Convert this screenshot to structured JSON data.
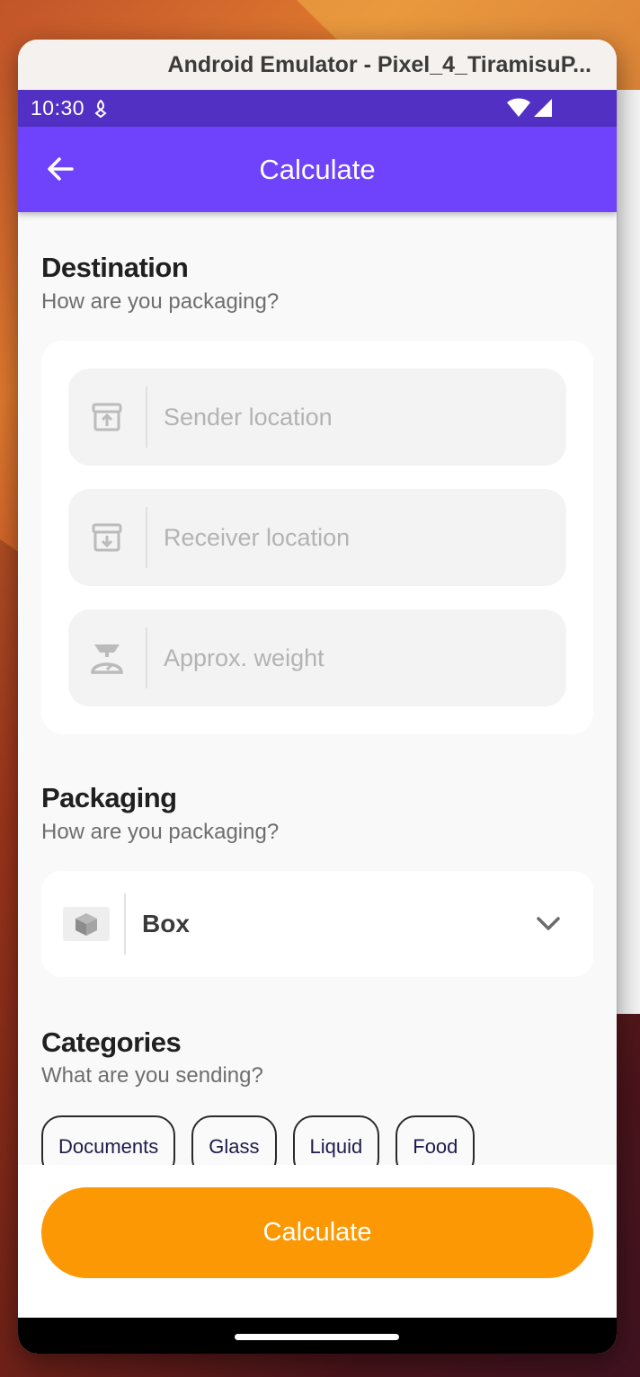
{
  "window": {
    "title": "Android Emulator - Pixel_4_TiramisuP..."
  },
  "status_bar": {
    "time": "10:30"
  },
  "app_bar": {
    "title": "Calculate"
  },
  "destination": {
    "title": "Destination",
    "subtitle": "How are you packaging?",
    "fields": [
      {
        "placeholder": "Sender location",
        "icon": "archive-up-icon"
      },
      {
        "placeholder": "Receiver location",
        "icon": "archive-down-icon"
      },
      {
        "placeholder": "Approx. weight",
        "icon": "scale-icon"
      }
    ]
  },
  "packaging": {
    "title": "Packaging",
    "subtitle": "How are you packaging?",
    "selected": "Box",
    "icon": "box-icon"
  },
  "categories": {
    "title": "Categories",
    "subtitle": "What are you sending?",
    "chips": [
      "Documents",
      "Glass",
      "Liquid",
      "Food"
    ]
  },
  "cta": {
    "label": "Calculate"
  },
  "colors": {
    "status_bar": "#5230c4",
    "app_bar": "#6f42fb",
    "cta": "#fb9804"
  }
}
